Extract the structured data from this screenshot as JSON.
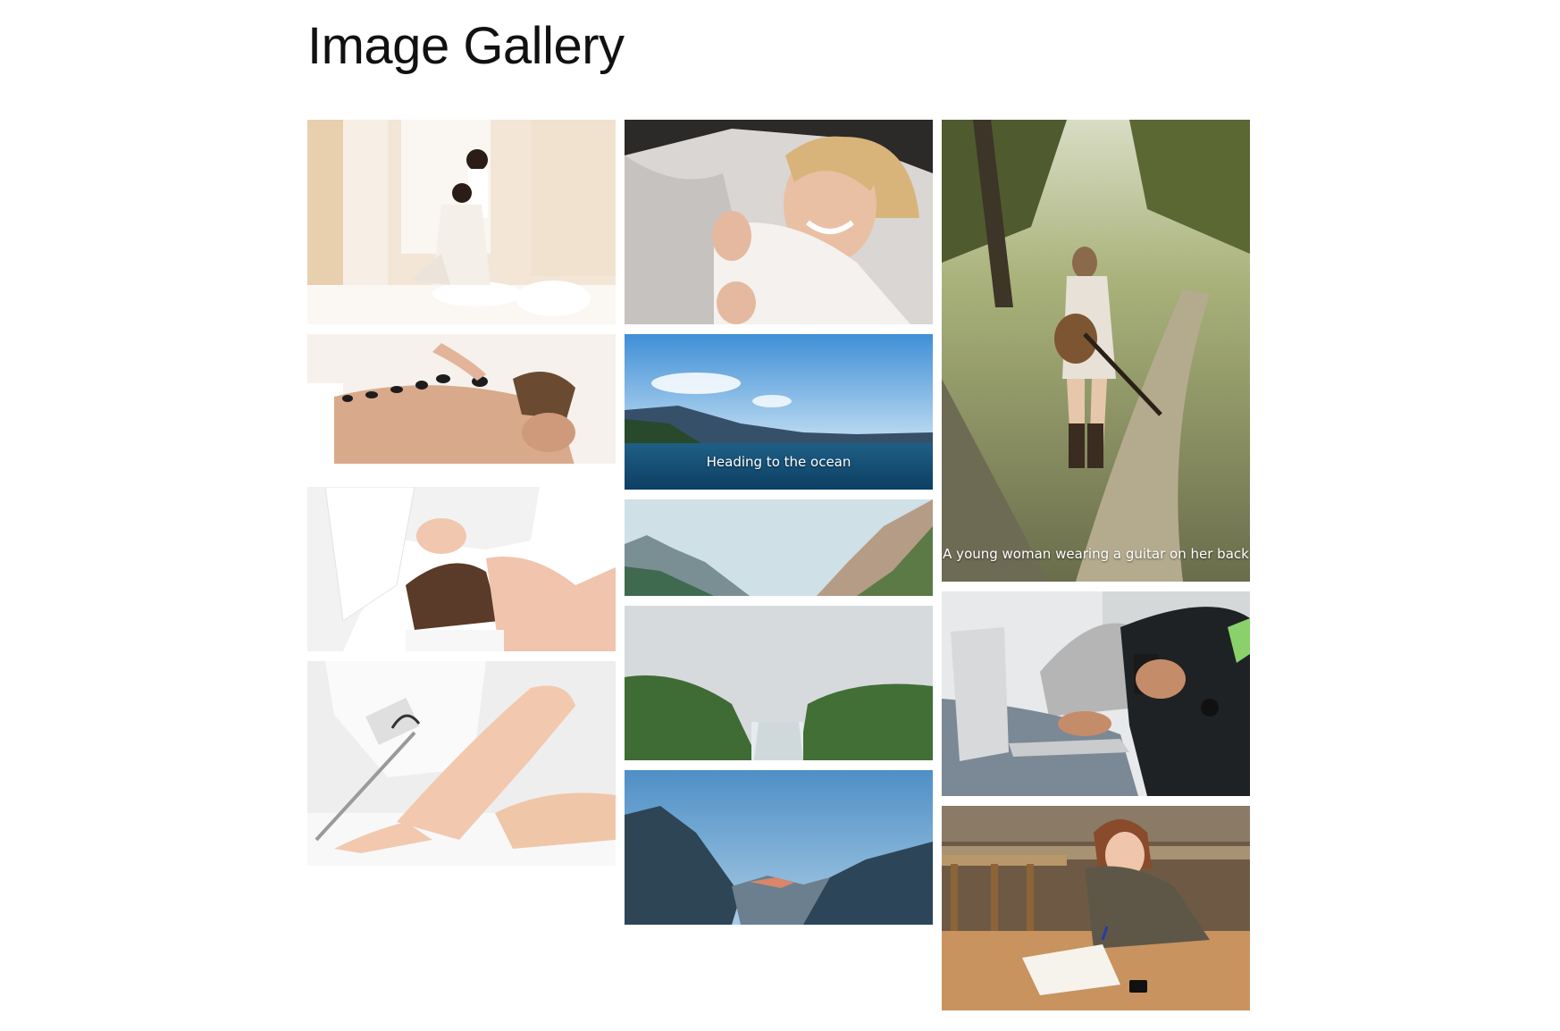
{
  "page": {
    "title": "Image Gallery"
  },
  "gallery": {
    "columns": [
      {
        "items": [
          {
            "subject": "thai-massage-photo",
            "caption": ""
          },
          {
            "subject": "hot-stone-massage-photo",
            "caption": ""
          },
          {
            "subject": "facial-massage-photo",
            "caption": ""
          },
          {
            "subject": "laser-hair-removal-photo",
            "caption": ""
          }
        ]
      },
      {
        "items": [
          {
            "subject": "bride-with-veil-photo",
            "caption": ""
          },
          {
            "subject": "ocean-lake-photo",
            "caption": "Heading to the ocean"
          },
          {
            "subject": "mountain-valley-photo",
            "caption": ""
          },
          {
            "subject": "waterfall-photo",
            "caption": ""
          },
          {
            "subject": "mountain-range-sky-photo",
            "caption": ""
          }
        ]
      },
      {
        "items": [
          {
            "subject": "woman-with-guitar-photo",
            "caption": "A young woman wearing a guitar on her back"
          },
          {
            "subject": "laptop-coffee-photo",
            "caption": ""
          },
          {
            "subject": "woman-writing-cafe-photo",
            "caption": ""
          }
        ]
      }
    ]
  },
  "colors": {
    "background": "#ffffff",
    "title": "#111111",
    "caption": "#ffffff"
  }
}
